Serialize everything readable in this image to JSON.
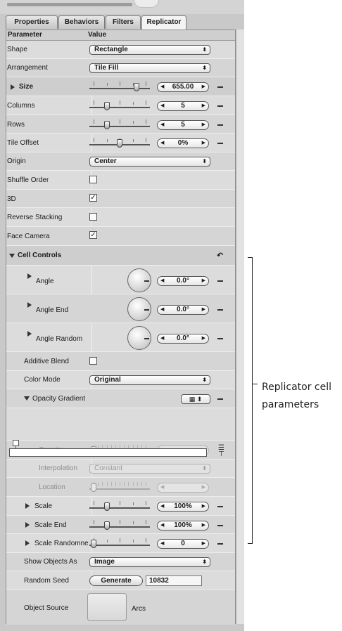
{
  "tabs": [
    "Properties",
    "Behaviors",
    "Filters",
    "Replicator"
  ],
  "header": {
    "parameter": "Parameter",
    "value": "Value"
  },
  "rows": {
    "shape": {
      "label": "Shape",
      "value": "Rectangle"
    },
    "arrangement": {
      "label": "Arrangement",
      "value": "Tile Fill"
    },
    "size": {
      "label": "Size",
      "value": "655.00",
      "level": 0.82
    },
    "columns": {
      "label": "Columns",
      "value": "5",
      "level": 0.25
    },
    "rows": {
      "label": "Rows",
      "value": "5",
      "level": 0.25
    },
    "tile_offset": {
      "label": "Tile Offset",
      "value": "0%",
      "level": 0.5
    },
    "origin": {
      "label": "Origin",
      "value": "Center"
    },
    "shuffle_order": {
      "label": "Shuffle Order",
      "checked": false
    },
    "three_d": {
      "label": "3D",
      "checked": true
    },
    "reverse_stacking": {
      "label": "Reverse Stacking",
      "checked": false
    },
    "face_camera": {
      "label": "Face Camera",
      "checked": true
    },
    "cell_controls": {
      "label": "Cell Controls"
    },
    "angle": {
      "label": "Angle",
      "value": "0.0°"
    },
    "angle_end": {
      "label": "Angle End",
      "value": "0.0°"
    },
    "angle_random": {
      "label": "Angle Random",
      "value": "0.0°"
    },
    "additive_blend": {
      "label": "Additive Blend",
      "checked": false
    },
    "color_mode": {
      "label": "Color Mode",
      "value": "Original"
    },
    "opacity_gradient": {
      "label": "Opacity Gradient"
    },
    "opacity": {
      "label": "Opacity",
      "value": "",
      "level": 0
    },
    "interpolation": {
      "label": "Interpolation",
      "value": "Constant"
    },
    "location": {
      "label": "Location",
      "value": "",
      "level": 0
    },
    "scale": {
      "label": "Scale",
      "value": "100%",
      "level": 0.25
    },
    "scale_end": {
      "label": "Scale End",
      "value": "100%",
      "level": 0.25
    },
    "scale_randomness": {
      "label": "Scale Randomness",
      "value": "0",
      "level": 0
    },
    "show_objects_as": {
      "label": "Show Objects As",
      "value": "Image"
    },
    "random_seed": {
      "label": "Random Seed",
      "button": "Generate",
      "value": "10832"
    },
    "object_source": {
      "label": "Object Source",
      "name": "Arcs"
    }
  },
  "callout": {
    "line1": "Replicator cell",
    "line2": "parameters"
  },
  "glyphs": {
    "check": "✓",
    "updown": "⬍",
    "left": "◀",
    "right": "▶",
    "reset": "↶"
  },
  "colors": {
    "panel": "#c9c9c9",
    "grid": "#dcdcdc"
  }
}
